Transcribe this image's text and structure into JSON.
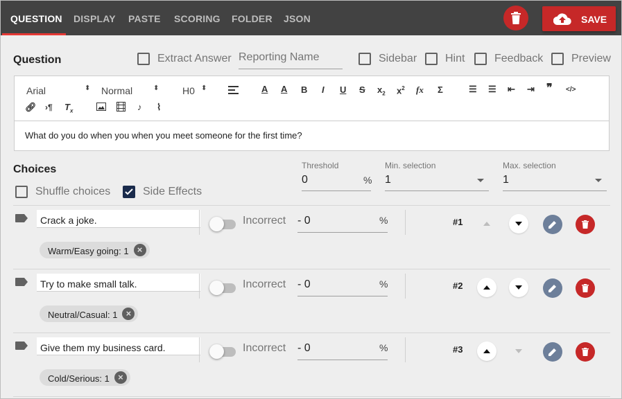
{
  "tabs": [
    {
      "label": "QUESTION",
      "active": true
    },
    {
      "label": "DISPLAY",
      "active": false
    },
    {
      "label": "PASTE",
      "active": false
    },
    {
      "label": "SCORING",
      "active": false
    },
    {
      "label": "FOLDER",
      "active": false
    },
    {
      "label": "JSON",
      "active": false
    }
  ],
  "topbar": {
    "delete_icon": "trash-icon",
    "save_label": "SAVE",
    "save_icon": "cloud-upload-icon",
    "accent_color": "#c62828",
    "bar_color": "#424242"
  },
  "question": {
    "heading": "Question",
    "extract_answer": {
      "label": "Extract Answer",
      "checked": false
    },
    "reporting_name_placeholder": "Reporting Name",
    "sidebar": {
      "label": "Sidebar",
      "checked": false
    },
    "hint": {
      "label": "Hint",
      "checked": false
    },
    "feedback": {
      "label": "Feedback",
      "checked": false
    },
    "preview": {
      "label": "Preview",
      "checked": false
    }
  },
  "editor": {
    "font_select": "Arial",
    "size_select": "Normal",
    "heading_select": "H0",
    "toolbar_icons": [
      "align-left-icon",
      "font-color-icon",
      "highlight-icon",
      "bold-icon",
      "italic-icon",
      "underline-icon",
      "strike-icon",
      "subscript-icon",
      "superscript-icon",
      "formula-icon",
      "sigma-icon",
      "ordered-list-icon",
      "bullet-list-icon",
      "outdent-icon",
      "indent-icon",
      "blockquote-icon",
      "code-icon",
      "link-icon",
      "rtl-icon",
      "clear-format-icon",
      "image-icon",
      "video-icon",
      "audio-icon",
      "attachment-icon"
    ],
    "text": "What do you do when you when you meet someone for the first time?"
  },
  "choices": {
    "heading": "Choices",
    "shuffle": {
      "label": "Shuffle choices",
      "checked": false
    },
    "side_effects": {
      "label": "Side Effects",
      "checked": true
    },
    "threshold_label": "Threshold",
    "threshold_value": "0",
    "threshold_unit": "%",
    "min_label": "Min. selection",
    "min_value": "1",
    "max_label": "Max. selection",
    "max_value": "1"
  },
  "choice_rows": [
    {
      "text": "Crack a joke.",
      "status": "Incorrect",
      "points": "- 0",
      "unit": "%",
      "number": "#1",
      "chip": "Warm/Easy going: 1",
      "up_disabled": true,
      "down_disabled": false
    },
    {
      "text": "Try to make small talk.",
      "status": "Incorrect",
      "points": "- 0",
      "unit": "%",
      "number": "#2",
      "chip": "Neutral/Casual: 1",
      "up_disabled": false,
      "down_disabled": false
    },
    {
      "text": "Give them my business card.",
      "status": "Incorrect",
      "points": "- 0",
      "unit": "%",
      "number": "#3",
      "chip": "Cold/Serious: 1",
      "up_disabled": false,
      "down_disabled": true
    }
  ]
}
